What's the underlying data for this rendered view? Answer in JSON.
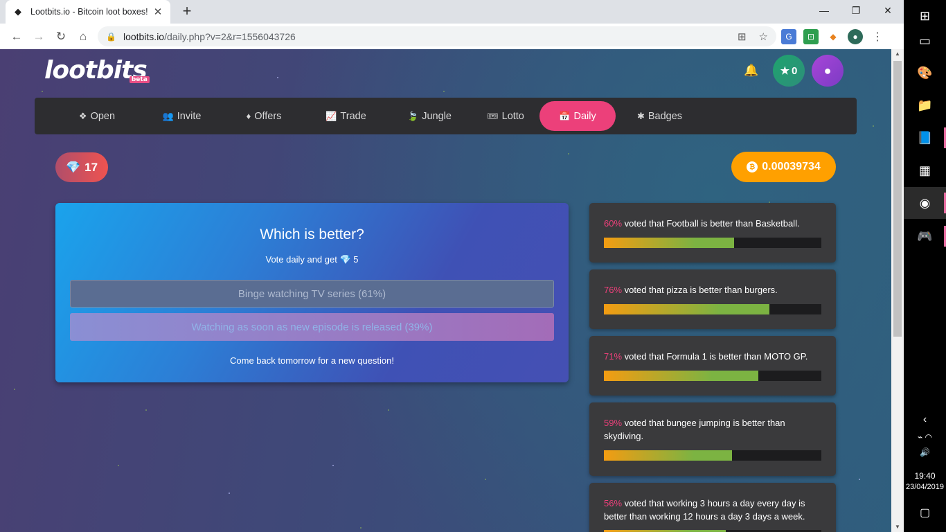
{
  "browser": {
    "tab_title": "Lootbits.io - Bitcoin loot boxes!",
    "url_host": "lootbits.io",
    "url_path": "/daily.php?v=2&r=1556043726"
  },
  "site": {
    "logo": "lootbits",
    "beta": "beta",
    "stars_count": "0",
    "gems": "17",
    "btc_balance": "0.00039734"
  },
  "nav": [
    {
      "label": "Open",
      "icon": "dropbox-icon",
      "active": false
    },
    {
      "label": "Invite",
      "icon": "users-icon",
      "active": false
    },
    {
      "label": "Offers",
      "icon": "fire-icon",
      "active": false
    },
    {
      "label": "Trade",
      "icon": "chart-line-icon",
      "active": false
    },
    {
      "label": "Jungle",
      "icon": "leaf-icon",
      "active": false
    },
    {
      "label": "Lotto",
      "icon": "ticket-icon",
      "active": false
    },
    {
      "label": "Daily",
      "icon": "calendar-icon",
      "active": true
    },
    {
      "label": "Badges",
      "icon": "badge-icon",
      "active": false
    }
  ],
  "question": {
    "title": "Which is better?",
    "subtitle_prefix": "Vote daily and get",
    "reward": "5",
    "option1": "Binge watching TV series (61%)",
    "option2": "Watching as soon as new episode is released (39%)",
    "footer": "Come back tomorrow for a new question!"
  },
  "results": [
    {
      "percent": 60,
      "pct_text": "60%",
      "text": " voted that Football is better than Basketball."
    },
    {
      "percent": 76,
      "pct_text": "76%",
      "text": " voted that pizza is better than burgers."
    },
    {
      "percent": 71,
      "pct_text": "71%",
      "text": " voted that Formula 1 is better than MOTO GP."
    },
    {
      "percent": 59,
      "pct_text": "59%",
      "text": " voted that bungee jumping is better than skydiving."
    },
    {
      "percent": 56,
      "pct_text": "56%",
      "text": " voted that working 3 hours a day every day is better than working 12 hours a day 3 days a week."
    }
  ],
  "taskbar": {
    "time": "19:40",
    "date": "23/04/2019"
  },
  "colors": {
    "accent_pink": "#ec407a",
    "btc_orange": "#ffa000",
    "nav_bg": "#2d2d30"
  }
}
